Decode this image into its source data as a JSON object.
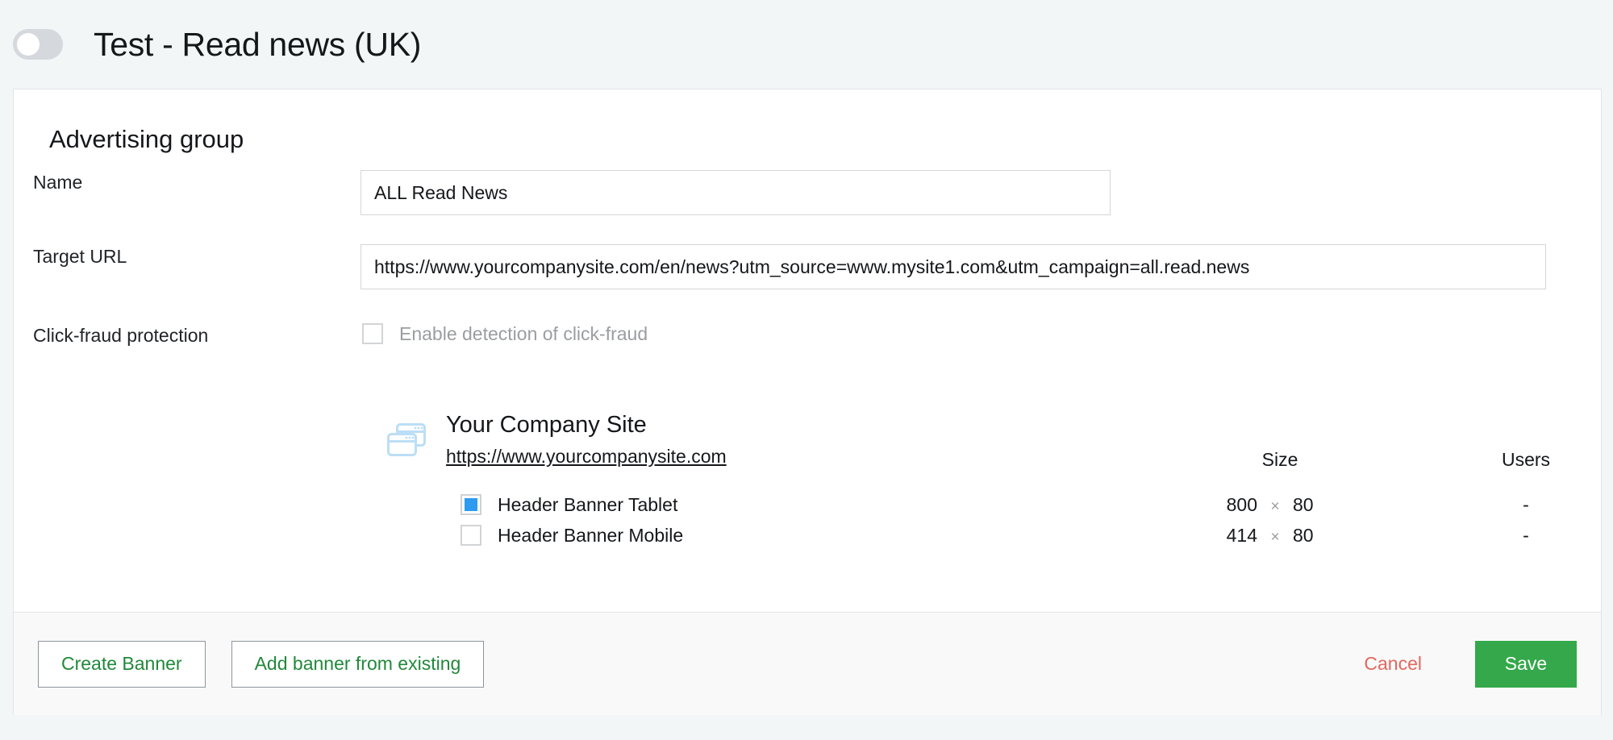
{
  "header": {
    "title": "Test - Read news (UK)",
    "toggle": {
      "name": "status-toggle",
      "state": "off"
    }
  },
  "card": {
    "section_title": "Advertising group",
    "fields": {
      "name": {
        "label": "Name",
        "value": "ALL Read News",
        "placeholder": ""
      },
      "target_url": {
        "label": "Target URL",
        "value": "https://www.yourcompanysite.com/en/news?utm_source=www.mysite1.com&utm_campaign=all.read.news",
        "placeholder": ""
      },
      "click_fraud": {
        "label": "Click-fraud protection",
        "checkbox_label": "Enable detection of click-fraud",
        "checked": false,
        "disabled": true
      }
    },
    "site": {
      "icon": "browser-windows-icon",
      "name": "Your Company Site",
      "url": "https://www.yourcompanysite.com",
      "columns": {
        "size": "Size",
        "users": "Users"
      },
      "banners": [
        {
          "name": "Header Banner Tablet",
          "checked": true,
          "width": "800",
          "times": "×",
          "height": "80",
          "users": "-"
        },
        {
          "name": "Header Banner Mobile",
          "checked": false,
          "width": "414",
          "times": "×",
          "height": "80",
          "users": "-"
        }
      ]
    }
  },
  "footer": {
    "create_banner": "Create Banner",
    "add_from_existing": "Add banner from existing",
    "cancel": "Cancel",
    "save": "Save"
  },
  "colors": {
    "page_bg": "#f2f6f7",
    "accent_green": "#34a84a",
    "link_green": "#21883a",
    "cancel_red": "#e2685f",
    "checkbox_blue": "#2e9bf0",
    "icon_blue": "#bcdef6",
    "toggle_track": "#d5d8dd"
  }
}
